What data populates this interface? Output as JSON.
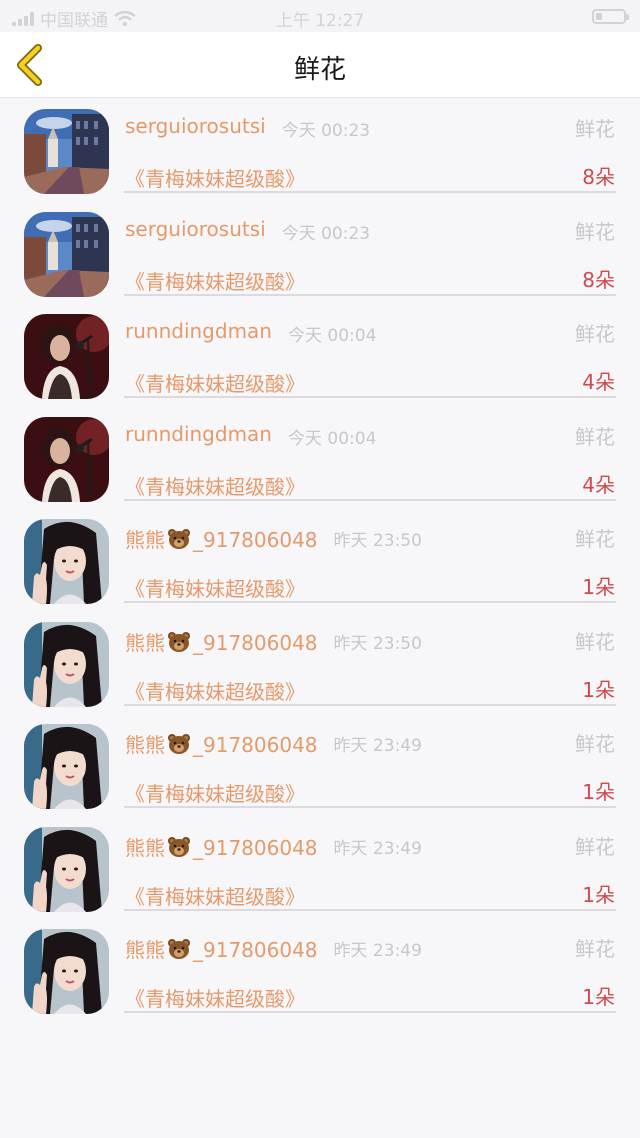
{
  "status_bar": {
    "carrier": "中国联通",
    "time": "上午 12:27"
  },
  "nav": {
    "title": "鲜花",
    "back_icon": "chevron-left-icon"
  },
  "colors": {
    "accent": "#e59a6a",
    "count": "#cf4b4b",
    "muted": "#c9c6cc"
  },
  "list": {
    "items": [
      {
        "user": "serguiorosutsi",
        "time": "今天 00:23",
        "type": "鲜花",
        "song": "《青梅妹妹超级酸》",
        "count": "8朵",
        "avatar": "city-street-avatar"
      },
      {
        "user": "serguiorosutsi",
        "time": "今天 00:23",
        "type": "鲜花",
        "song": "《青梅妹妹超级酸》",
        "count": "8朵",
        "avatar": "city-street-avatar"
      },
      {
        "user": "runndingdman",
        "time": "今天 00:04",
        "type": "鲜花",
        "song": "《青梅妹妹超级酸》",
        "count": "4朵",
        "avatar": "singer-avatar"
      },
      {
        "user": "runndingdman",
        "time": "今天 00:04",
        "type": "鲜花",
        "song": "《青梅妹妹超级酸》",
        "count": "4朵",
        "avatar": "singer-avatar"
      },
      {
        "user_prefix": "熊熊",
        "user_suffix": "_917806048",
        "time": "昨天 23:50",
        "type": "鲜花",
        "song": "《青梅妹妹超级酸》",
        "count": "1朵",
        "avatar": "girl-peace-sign-avatar"
      },
      {
        "user_prefix": "熊熊",
        "user_suffix": "_917806048",
        "time": "昨天 23:50",
        "type": "鲜花",
        "song": "《青梅妹妹超级酸》",
        "count": "1朵",
        "avatar": "girl-peace-sign-avatar"
      },
      {
        "user_prefix": "熊熊",
        "user_suffix": "_917806048",
        "time": "昨天 23:49",
        "type": "鲜花",
        "song": "《青梅妹妹超级酸》",
        "count": "1朵",
        "avatar": "girl-peace-sign-avatar"
      },
      {
        "user_prefix": "熊熊",
        "user_suffix": "_917806048",
        "time": "昨天 23:49",
        "type": "鲜花",
        "song": "《青梅妹妹超级酸》",
        "count": "1朵",
        "avatar": "girl-peace-sign-avatar"
      },
      {
        "user_prefix": "熊熊",
        "user_suffix": "_917806048",
        "time": "昨天 23:49",
        "type": "鲜花",
        "song": "《青梅妹妹超级酸》",
        "count": "1朵",
        "avatar": "girl-peace-sign-avatar"
      }
    ]
  }
}
